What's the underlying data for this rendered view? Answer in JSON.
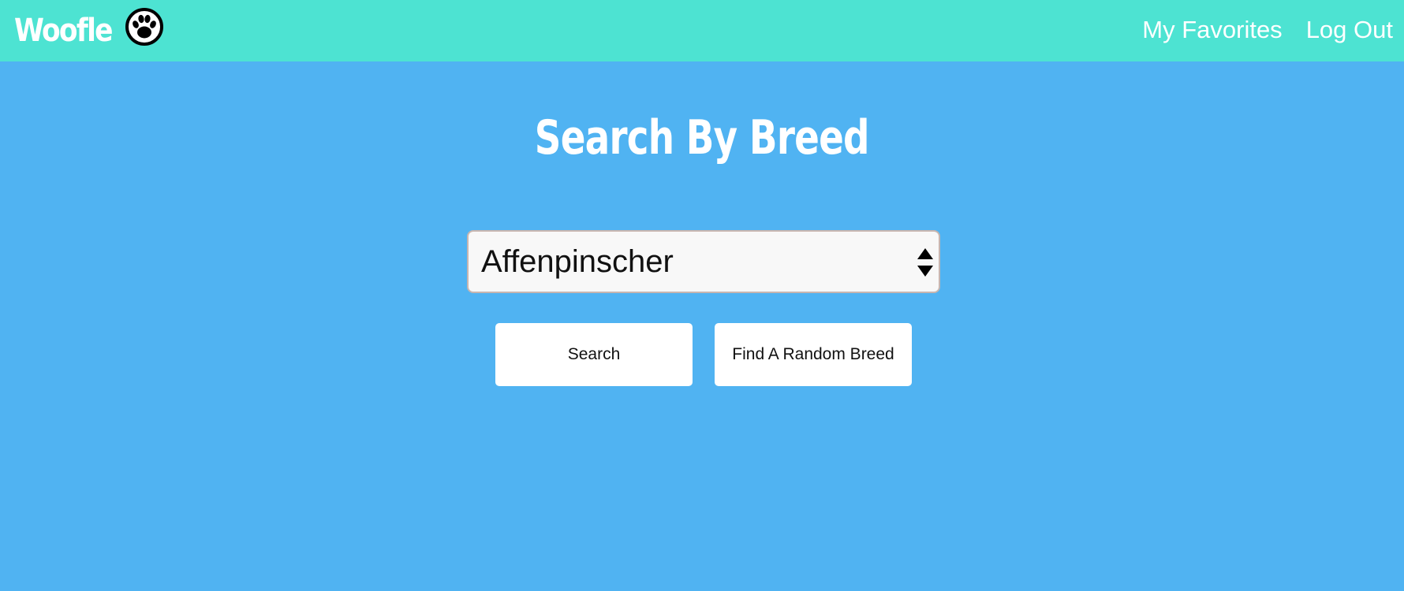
{
  "navbar": {
    "brand_name": "Woofle",
    "brand_icon": "paw-icon",
    "links": [
      {
        "label": "My Favorites"
      },
      {
        "label": "Log Out"
      }
    ],
    "background_color": "#4de3d2"
  },
  "main": {
    "title": "Search By Breed",
    "breed_select": {
      "selected_value": "Affenpinscher"
    },
    "buttons": {
      "search_label": "Search",
      "random_label": "Find A Random Breed"
    },
    "background_color": "#50b3f2"
  }
}
